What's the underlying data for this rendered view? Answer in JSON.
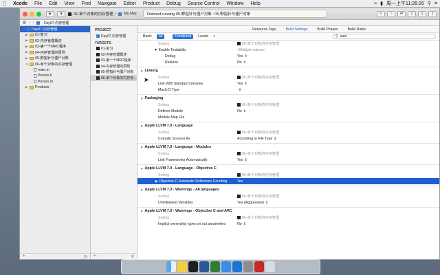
{
  "menubar": {
    "app": "Xcode",
    "items": [
      "File",
      "Edit",
      "View",
      "Find",
      "Navigate",
      "Editor",
      "Product",
      "Debug",
      "Source Control",
      "Window",
      "Help"
    ],
    "clock": "周一上午11:26:26"
  },
  "toolbar": {
    "scheme": "06-单个对象的内存管理",
    "destination": "My Mac",
    "activity": "Finished running 05-野指针与僵尸对象 : 05-野指针与僵尸对象"
  },
  "tabbar": {
    "breadcrumb": "Day07-内存管理"
  },
  "navigator": {
    "project": "Day07-内存管理",
    "items": [
      {
        "label": "01-复习",
        "kind": "folder"
      },
      {
        "label": "02-内存管理概述",
        "kind": "folder"
      },
      {
        "label": "03-第一个MRC程序",
        "kind": "folder"
      },
      {
        "label": "04-内存管理的原则",
        "kind": "folder"
      },
      {
        "label": "05-野指针与僵尸对象",
        "kind": "folder"
      },
      {
        "label": "06-单个对象的内存管理",
        "kind": "folder"
      },
      {
        "label": "main.m",
        "kind": "file"
      },
      {
        "label": "Person.h",
        "kind": "file"
      },
      {
        "label": "Person.m",
        "kind": "file"
      },
      {
        "label": "Products",
        "kind": "folder"
      }
    ]
  },
  "targets": {
    "project_header": "PROJECT",
    "project_item": "Day07-内存管理",
    "targets_header": "TARGETS",
    "items": [
      "01-复习",
      "02-内存管理概述",
      "03-第一个MRC程序",
      "04-内存管理的原则",
      "05-野指针与僵尸对象",
      "06-单个对象的内存管..."
    ]
  },
  "editor": {
    "tabs": [
      "Resource Tags",
      "Build Settings",
      "Build Phases",
      "Build Rules"
    ],
    "active_tab": "Build Settings",
    "filters": [
      "Basic",
      "All",
      "Combined",
      "Levels"
    ],
    "search": "auto",
    "setting_header": "Setting",
    "target_col": "06-单个对象的内存管理",
    "enable_testability": {
      "name": "Enable Testability",
      "value": "<Multiple values>",
      "debug_label": "Debug",
      "debug_value": "Yes",
      "release_label": "Release",
      "release_value": "No"
    },
    "linking": {
      "title": "Linking",
      "rows": [
        {
          "name": "Link With Standard Libraries",
          "value": "Yes"
        },
        {
          "name": "Mach-O Type",
          "value": ""
        }
      ]
    },
    "packaging": {
      "title": "Packaging",
      "rows": [
        {
          "name": "Defines Module",
          "value": "No"
        },
        {
          "name": "Module Map File",
          "value": ""
        }
      ]
    },
    "language": {
      "title": "Apple LLVM 7.0 - Language",
      "rows": [
        {
          "name": "Compile Sources As",
          "value": "According to File Type"
        }
      ]
    },
    "modules": {
      "title": "Apple LLVM 7.0 - Language - Modules",
      "rows": [
        {
          "name": "Link Frameworks Automatically",
          "value": "Yes"
        }
      ]
    },
    "objc": {
      "title": "Apple LLVM 7.0 - Language - Objective C",
      "rows": [
        {
          "name": "Objective-C Automatic Reference Counting",
          "value": "Yes"
        }
      ]
    },
    "warnings": {
      "title": "Apple LLVM 7.0 - Warnings - All languages",
      "rows": [
        {
          "name": "Uninitialized Variables",
          "value": "Yes (Aggressive)"
        }
      ]
    },
    "warnings_arc": {
      "title": "Apple LLVM 7.0 - Warnings - Objective C and ARC",
      "rows": [
        {
          "name": "Implicit ownership types on out parameters",
          "value": "No"
        }
      ]
    }
  },
  "colors": {
    "selection": "#1f5fcf",
    "accent_blue": "#2d73d6"
  },
  "dock": {
    "apps": [
      "finder",
      "notes",
      "terminal",
      "word",
      "excel",
      "safari",
      "xcode",
      "preferences",
      "simulator",
      "trash"
    ]
  }
}
